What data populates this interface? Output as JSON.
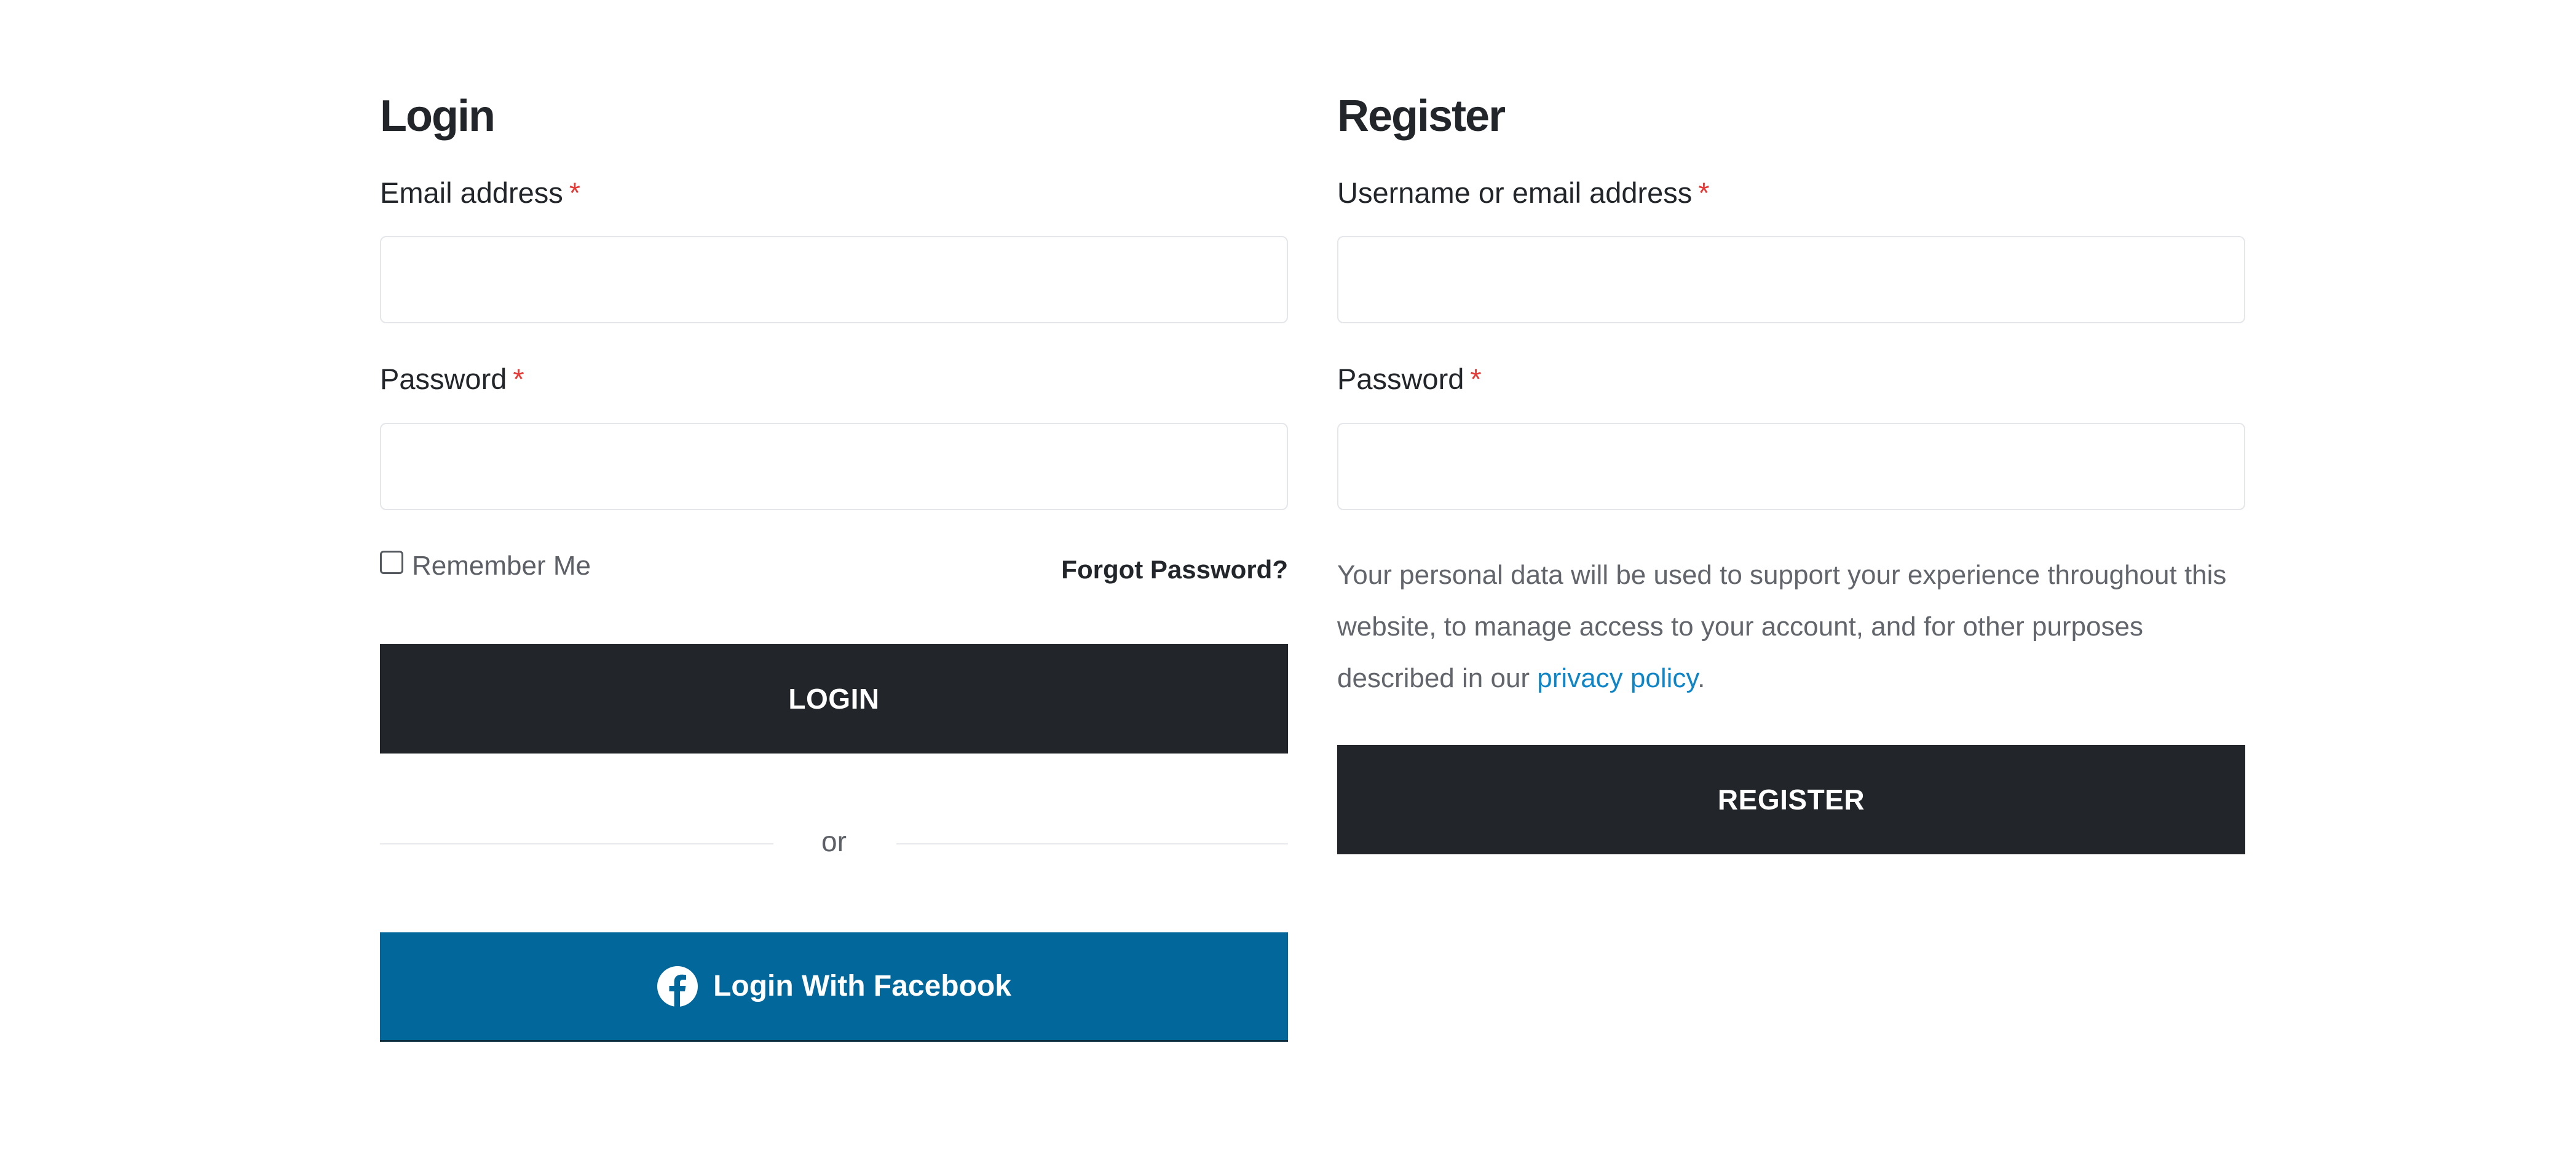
{
  "login": {
    "title": "Login",
    "email_label": "Email address",
    "required_mark": "*",
    "email_value": "",
    "password_label": "Password",
    "password_value": "",
    "remember_label": "Remember Me",
    "remember_checked": false,
    "forgot_label": "Forgot Password?",
    "submit_label": "LOGIN",
    "divider_label": "or",
    "facebook_label": "Login With Facebook",
    "facebook_icon": "facebook-icon"
  },
  "register": {
    "title": "Register",
    "username_label": "Username or email address",
    "required_mark": "*",
    "username_value": "",
    "password_label": "Password",
    "password_value": "",
    "privacy_text_before": "Your personal data will be used to support your experience throughout this website, to manage access to your account, and for other purposes described in our ",
    "privacy_link_label": "privacy policy",
    "privacy_text_after": ".",
    "submit_label": "REGISTER"
  },
  "colors": {
    "text": "#222529",
    "button_dark": "#222529",
    "facebook_blue": "#02679a",
    "required_red": "#e53935",
    "link_blue": "#0e85c7"
  }
}
